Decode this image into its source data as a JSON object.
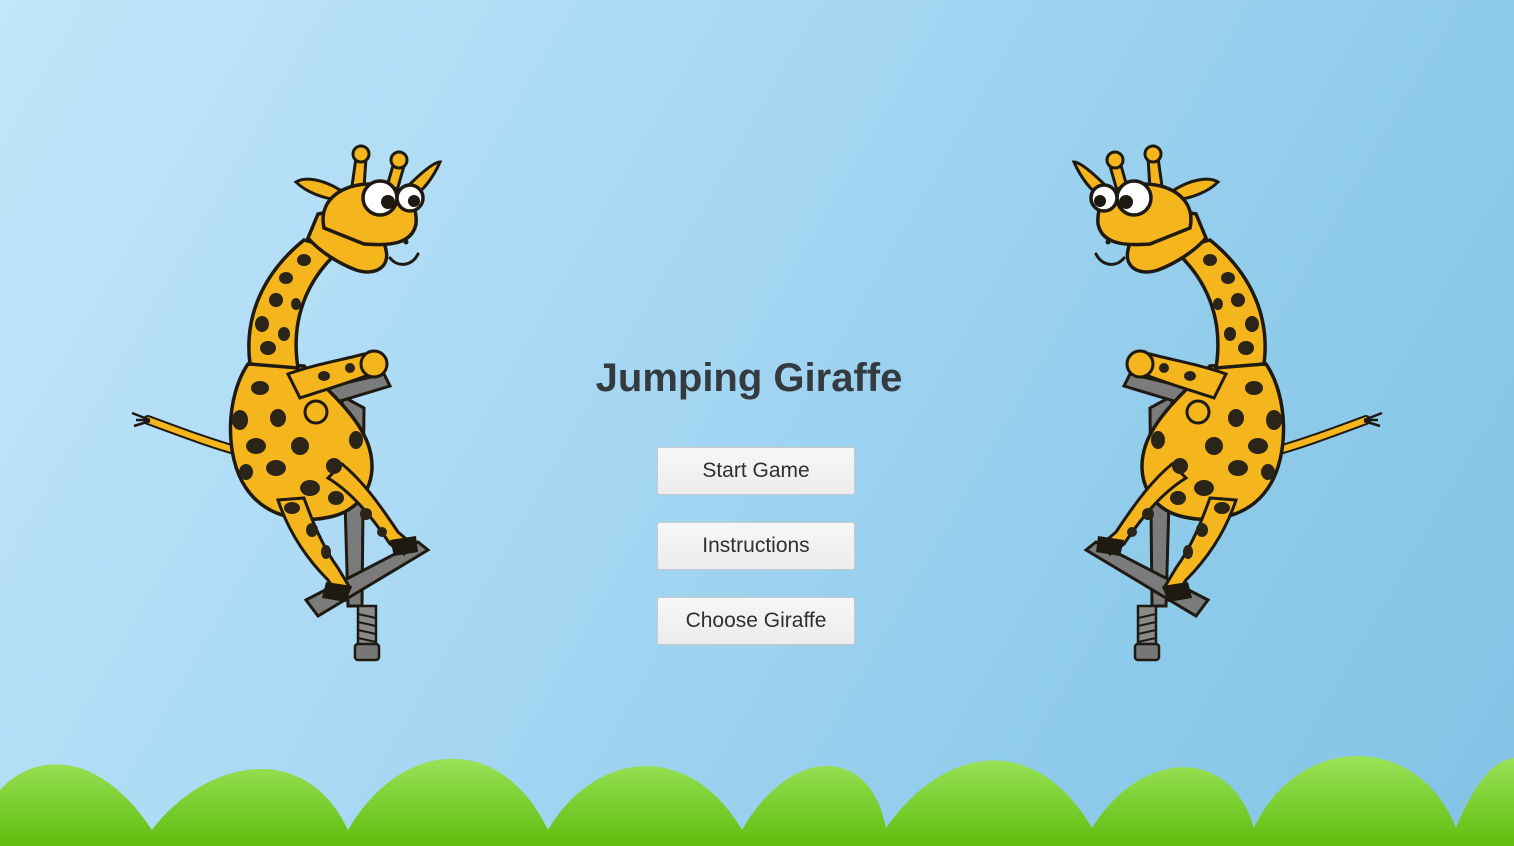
{
  "game": {
    "title": "Jumping Giraffe"
  },
  "menu": {
    "start_label": "Start Game",
    "instructions_label": "Instructions",
    "choose_label": "Choose Giraffe"
  },
  "colors": {
    "sky_top": "#c2e6fb",
    "sky_bottom": "#84c3e6",
    "grass_light": "#9be35a",
    "grass_dark": "#5fbd0e",
    "giraffe_body": "#f5b51c",
    "giraffe_spots": "#2a2419",
    "pogo_stick": "#7a7a7a",
    "title_text": "#333a40"
  }
}
